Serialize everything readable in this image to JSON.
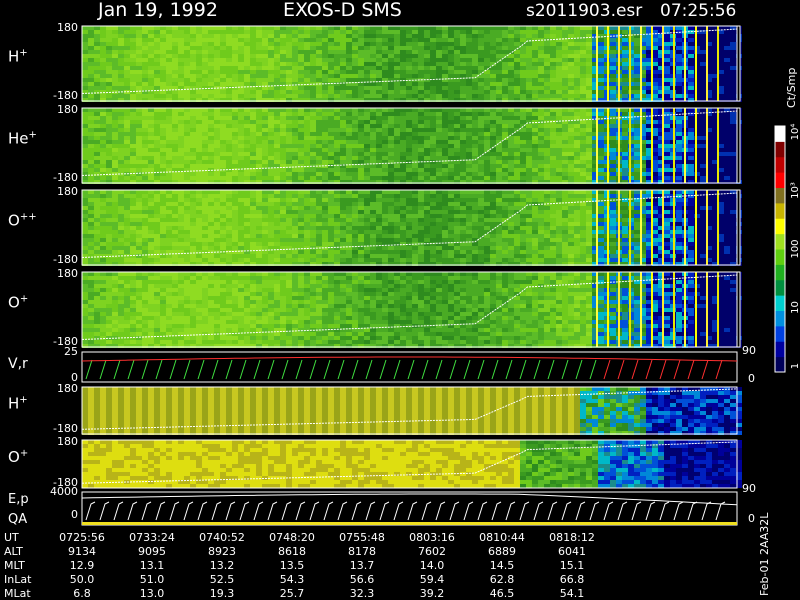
{
  "header": {
    "date": "Jan 19, 1992",
    "instrument": "EXOS-D SMS",
    "file": "s2011903.esr",
    "time": "07:25:56"
  },
  "side_label": "Feb-01 2AA32L",
  "colorbar": {
    "unit": "Ct/Smp",
    "ticks": [
      "1",
      "10",
      "100",
      "10³",
      "10⁴"
    ],
    "scale": "log",
    "range": [
      1,
      10000
    ],
    "colors": [
      "#00005a",
      "#0000a0",
      "#0040e0",
      "#0090e0",
      "#00d0d0",
      "#009040",
      "#20b020",
      "#60d010",
      "#a0e020",
      "#ffff00",
      "#c8b400",
      "#807020",
      "#ff0000",
      "#c00000",
      "#800000",
      "#ffffff"
    ]
  },
  "panels": [
    {
      "label": "H",
      "sup": "+",
      "ymax": "180",
      "ymin": "-180"
    },
    {
      "label": "He",
      "sup": "+",
      "ymax": "180",
      "ymin": "-180"
    },
    {
      "label": "O",
      "sup": "++",
      "ymax": "180",
      "ymin": "-180"
    },
    {
      "label": "O",
      "sup": "+",
      "ymax": "180",
      "ymin": "-180"
    }
  ],
  "vr_panel": {
    "label": "V,r",
    "ymax": "25",
    "ymin": "0",
    "right_top": "90",
    "right_bottom": "0"
  },
  "lower_panels": [
    {
      "label": "H",
      "sup": "+",
      "ymax": "180",
      "ymin": "-180"
    },
    {
      "label": "O",
      "sup": "+",
      "ymax": "180",
      "ymin": "-180"
    }
  ],
  "ep_panel": {
    "label1": "E,p",
    "label2": "QA",
    "ymax": "4000",
    "ymin": "0",
    "right_top": "90",
    "right_bottom": "0"
  },
  "table": {
    "row_labels": [
      "UT",
      "ALT",
      "MLT",
      "InLat",
      "MLat"
    ],
    "columns": [
      [
        "0725:56",
        "9134",
        "12.9",
        "50.0",
        "6.8"
      ],
      [
        "0733:24",
        "9095",
        "13.1",
        "51.0",
        "13.0"
      ],
      [
        "0740:52",
        "8923",
        "13.2",
        "52.5",
        "19.3"
      ],
      [
        "0748:20",
        "8618",
        "13.5",
        "54.3",
        "25.7"
      ],
      [
        "0755:48",
        "8178",
        "13.7",
        "56.6",
        "32.3"
      ],
      [
        "0803:16",
        "7602",
        "14.0",
        "59.4",
        "39.2"
      ],
      [
        "0810:44",
        "6889",
        "14.5",
        "62.8",
        "46.5"
      ],
      [
        "0818:12",
        "6041",
        "15.1",
        "66.8",
        "54.1"
      ]
    ]
  },
  "chart_data": {
    "type": "heatmap",
    "title": "Jan 19, 1992 EXOS-D SMS",
    "x": [
      "0725:56",
      "0733:24",
      "0740:52",
      "0748:20",
      "0755:48",
      "0803:16",
      "0810:44",
      "0818:12"
    ],
    "series": [
      {
        "name": "H+",
        "ylim": [
          -180,
          180
        ]
      },
      {
        "name": "He+",
        "ylim": [
          -180,
          180
        ]
      },
      {
        "name": "O++",
        "ylim": [
          -180,
          180
        ]
      },
      {
        "name": "O+",
        "ylim": [
          -180,
          180
        ]
      },
      {
        "name": "V,r",
        "ylim": [
          0,
          25
        ]
      },
      {
        "name": "H+",
        "ylim": [
          -180,
          180
        ]
      },
      {
        "name": "O+",
        "ylim": [
          -180,
          180
        ]
      },
      {
        "name": "E,p",
        "ylim": [
          0,
          4000
        ]
      }
    ],
    "colorbar": {
      "label": "Ct/Smp",
      "scale": "log",
      "range": [
        1,
        10000
      ]
    }
  }
}
